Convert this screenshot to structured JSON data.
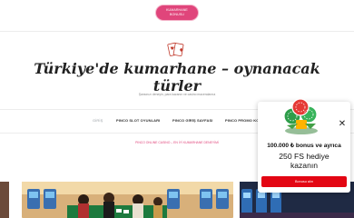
{
  "top_button": {
    "label_line1": "KUMARHANE",
    "label_line2": "BONUSU"
  },
  "header": {
    "logo_icon": "playing-cards-icon",
    "title": "Türkiye'de kumarhane – oynanacak türler",
    "tagline": "Şansınızı deneyin, para kazanın ve casino maceralarına"
  },
  "nav": {
    "items": [
      {
        "label": "GİRİŞ",
        "active": true
      },
      {
        "label": "PINCO SLOT OYUNLARI",
        "active": false
      },
      {
        "label": "PINCO GİRİŞ SAYFASI",
        "active": false
      },
      {
        "label": "PINCO PROMO KO",
        "active": false
      }
    ],
    "subnav": "PINCO ONLINE CASINO – EN İYİ KUMARHANE DENEYİMİ"
  },
  "popup": {
    "bonus_text": "100.000 ₺ bonus ve ayrıca",
    "free_spins_line1": "250 FS hediye",
    "free_spins_line2": "kazanın",
    "cta_label": "Bonusu alın",
    "close_icon": "close-icon"
  },
  "colors": {
    "accent_pink": "#e0457b",
    "cta_red": "#e30613"
  }
}
